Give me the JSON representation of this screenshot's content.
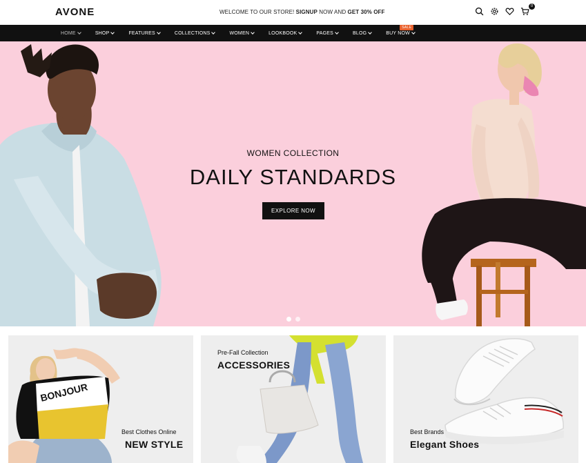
{
  "header": {
    "logo": "AVONE",
    "promo_prefix": "WELCOME TO OUR STORE! ",
    "promo_signup": "SIGNUP",
    "promo_middle": " NOW AND ",
    "promo_offer": "GET 30% OFF",
    "cart_count": "0",
    "icons": [
      "search-icon",
      "gear-icon",
      "heart-icon",
      "cart-icon"
    ]
  },
  "nav": {
    "items": [
      {
        "label": "HOME"
      },
      {
        "label": "SHOP"
      },
      {
        "label": "FEATURES"
      },
      {
        "label": "COLLECTIONS"
      },
      {
        "label": "WOMEN"
      },
      {
        "label": "LOOKBOOK"
      },
      {
        "label": "PAGES"
      },
      {
        "label": "BLOG"
      },
      {
        "label": "BUY NOW"
      }
    ],
    "badge": "SALE"
  },
  "hero": {
    "subtitle": "WOMEN COLLECTION",
    "title": "DAILY STANDARDS",
    "button": "EXPLORE NOW",
    "background": "#fbcfdc",
    "slides": 2,
    "active_slide": 1
  },
  "banners": [
    {
      "small": "Best Clothes Online",
      "big": "NEW STYLE"
    },
    {
      "small": "Pre-Fall Collection",
      "big": "ACCESSORIES"
    },
    {
      "small": "Best Brands",
      "big": "Elegant Shoes"
    }
  ],
  "shirt_print": "BONJOUR",
  "colors": {
    "nav_bg": "#111111",
    "badge": "#e9612d",
    "banner_bg": "#eeeeee"
  }
}
